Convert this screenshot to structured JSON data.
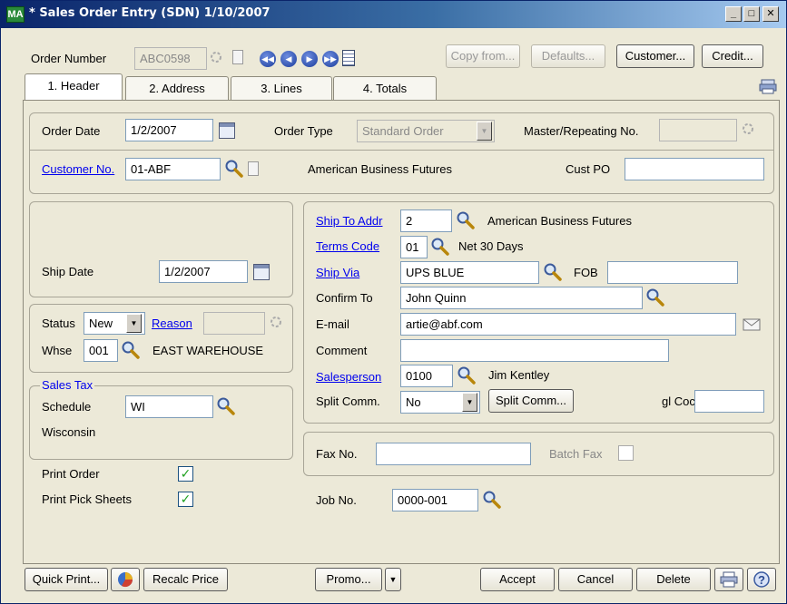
{
  "window": {
    "title": "* Sales Order Entry (SDN) 1/10/2007",
    "app_icon": "MA",
    "controls": [
      "_",
      "□",
      "✕"
    ]
  },
  "top": {
    "order_number_label": "Order Number",
    "order_number_value": "ABC0598",
    "copy_from": "Copy from...",
    "defaults": "Defaults...",
    "customer": "Customer...",
    "credit": "Credit..."
  },
  "tabs": [
    "1. Header",
    "2. Address",
    "3. Lines",
    "4. Totals"
  ],
  "header": {
    "order_date_label": "Order Date",
    "order_date": "1/2/2007",
    "order_type_label": "Order Type",
    "order_type": "Standard Order",
    "master_label": "Master/Repeating No.",
    "customer_no_label": "Customer No.",
    "customer_no": "01-ABF",
    "customer_name": "American Business Futures",
    "cust_po_label": "Cust PO",
    "cust_po": "",
    "ship_date_label": "Ship Date",
    "ship_date": "1/2/2007",
    "status_label": "Status",
    "status": "New",
    "reason_label": "Reason",
    "whse_label": "Whse",
    "whse": "001",
    "whse_name": "EAST WAREHOUSE",
    "sales_tax_label": "Sales Tax",
    "schedule_label": "Schedule",
    "schedule": "WI",
    "schedule_name": "Wisconsin",
    "print_order_label": "Print Order",
    "print_pick_label": "Print Pick Sheets"
  },
  "right": {
    "ship_to_label": "Ship To Addr",
    "ship_to": "2",
    "ship_to_name": "American Business Futures",
    "terms_label": "Terms Code",
    "terms": "01",
    "terms_name": "Net 30 Days",
    "ship_via_label": "Ship Via",
    "ship_via": "UPS BLUE",
    "fob_label": "FOB",
    "confirm_label": "Confirm To",
    "confirm_to": "John Quinn",
    "email_label": "E-mail",
    "email": "artie@abf.com",
    "comment_label": "Comment",
    "salesperson_label": "Salesperson",
    "salesperson": "0100",
    "salesperson_name": "Jim Kentley",
    "split_label": "Split Comm.",
    "split_value": "No",
    "split_button": "Split Comm...",
    "gl_label": "gl Coc",
    "fax_label": "Fax No.",
    "batch_fax_label": "Batch Fax",
    "job_label": "Job No.",
    "job_no": "0000-001"
  },
  "bottom": {
    "quick_print": "Quick Print...",
    "recalc": "Recalc Price",
    "promo": "Promo...",
    "accept": "Accept",
    "cancel": "Cancel",
    "delete": "Delete"
  }
}
